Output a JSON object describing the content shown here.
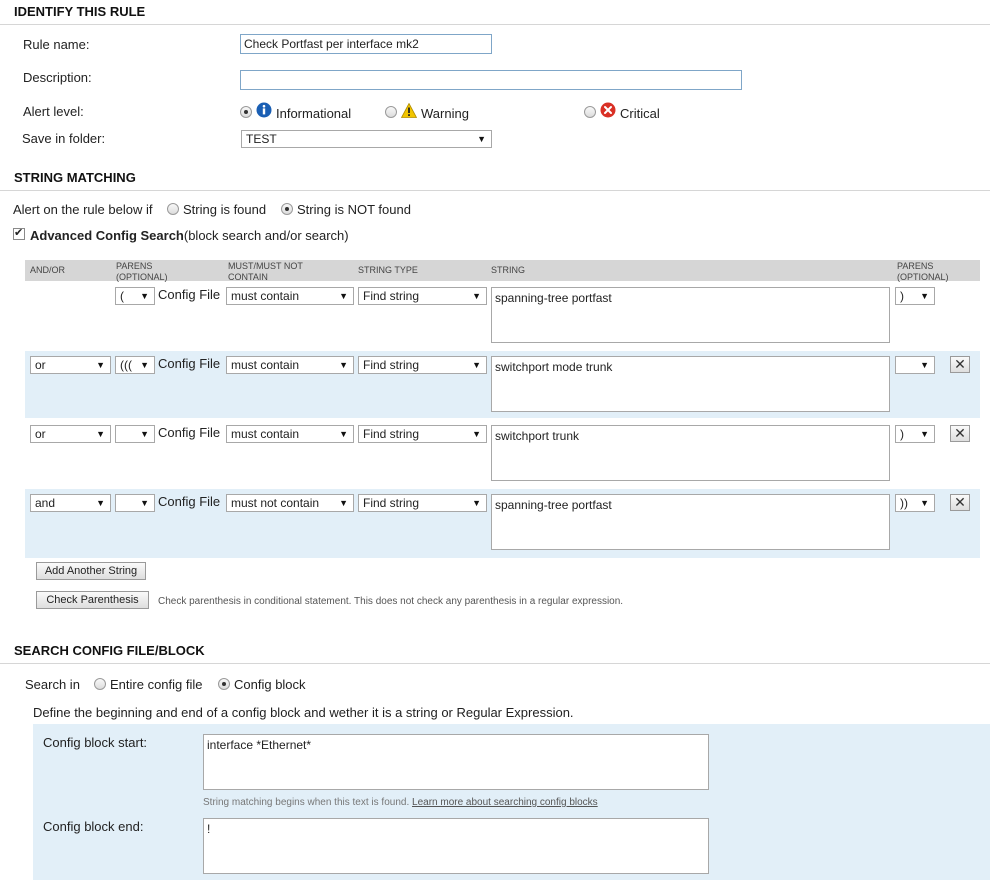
{
  "identify": {
    "title": "IDENTIFY THIS RULE",
    "rule_name_label": "Rule name:",
    "rule_name_value": "Check Portfast per interface mk2",
    "description_label": "Description:",
    "description_value": "",
    "alert_level_label": "Alert level:",
    "alert_levels": [
      {
        "label": "Informational",
        "selected": true,
        "icon": "info-icon"
      },
      {
        "label": "Warning",
        "selected": false,
        "icon": "warning-icon"
      },
      {
        "label": "Critical",
        "selected": false,
        "icon": "critical-icon"
      }
    ],
    "save_folder_label": "Save in folder:",
    "save_folder_value": "TEST"
  },
  "string_matching": {
    "title": "STRING MATCHING",
    "alert_prefix": "Alert on the rule below if",
    "found_label": "String is found",
    "not_found_label": "String is NOT found",
    "selected": "not_found",
    "advanced_label": "Advanced Config Search",
    "advanced_suffix": "(block search and/or search)",
    "advanced_checked": true,
    "headers": {
      "andor": "AND/OR",
      "parens1_line1": "PARENS",
      "parens1_line2": "(OPTIONAL)",
      "must_line1": "MUST/MUST NOT",
      "must_line2": "CONTAIN",
      "type": "STRING TYPE",
      "string": "STRING",
      "parens2_line1": "PARENS",
      "parens2_line2": "(OPTIONAL)"
    },
    "rows": [
      {
        "andor": "",
        "open": "(",
        "source": "Config File",
        "must": "must contain",
        "type": "Find string",
        "string": "spanning-tree portfast",
        "close": ")"
      },
      {
        "andor": "or",
        "open": "(((",
        "source": "Config File",
        "must": "must contain",
        "type": "Find string",
        "string": "switchport mode trunk",
        "close": ""
      },
      {
        "andor": "or",
        "open": "",
        "source": "Config File",
        "must": "must contain",
        "type": "Find string",
        "string": "switchport trunk",
        "close": ")"
      },
      {
        "andor": "and",
        "open": "",
        "source": "Config File",
        "must": "must not contain",
        "type": "Find string",
        "string": "spanning-tree portfast",
        "close": "))"
      }
    ],
    "add_button": "Add Another String",
    "check_button": "Check Parenthesis",
    "check_note": "Check parenthesis in conditional statement. This does not check any parenthesis in a regular expression."
  },
  "search_block": {
    "title": "SEARCH CONFIG FILE/BLOCK",
    "search_in_label": "Search in",
    "entire_label": "Entire config file",
    "block_label": "Config block",
    "selected": "block",
    "define_text": "Define the beginning and end of a config block and wether it is a string or Regular Expression.",
    "start_label": "Config block start:",
    "start_value": "interface *Ethernet*",
    "start_hint": "String matching begins when this text is found.",
    "start_hint_link": "Learn more about searching config blocks",
    "end_label": "Config block end:",
    "end_value": "!"
  },
  "colors": {
    "row_highlight": "#e2eff8",
    "header_bar": "#d6d6d6",
    "input_border": "#7fa6c8",
    "info_blue": "#1a5fb4",
    "warning_yellow": "#f2c500",
    "critical_red": "#d93025"
  }
}
